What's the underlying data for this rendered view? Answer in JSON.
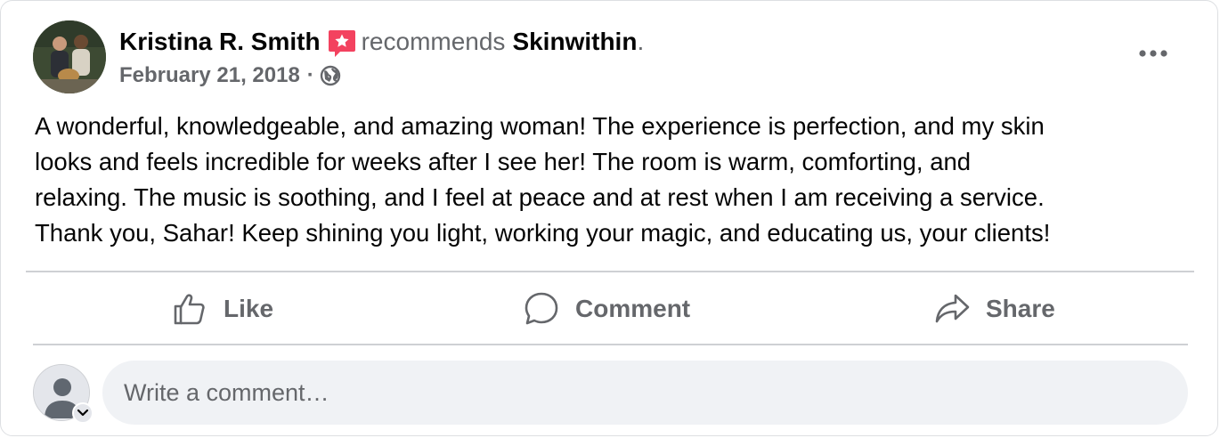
{
  "post": {
    "author": "Kristina R. Smith",
    "verb": "recommends",
    "page": "Skinwithin",
    "period": ".",
    "date": "February 21, 2018",
    "separator": "·",
    "privacy_icon": "globe-icon",
    "recommend_badge_color": "#f3425f",
    "body_lines": [
      "A wonderful, knowledgeable, and amazing woman! The experience is perfection, and my skin",
      "looks and feels incredible for weeks after I see her! The room is warm, comforting, and",
      "relaxing. The music is soothing, and I feel at peace and at rest when I am receiving a service.",
      "Thank you, Sahar! Keep shining you light, working your magic, and educating us, your clients!"
    ]
  },
  "actions": {
    "like": "Like",
    "comment": "Comment",
    "share": "Share"
  },
  "composer": {
    "placeholder": "Write a comment…"
  },
  "colors": {
    "secondary_text": "#65676b",
    "primary_text": "#050505",
    "divider": "#ced0d4",
    "input_bg": "#f0f2f5"
  }
}
